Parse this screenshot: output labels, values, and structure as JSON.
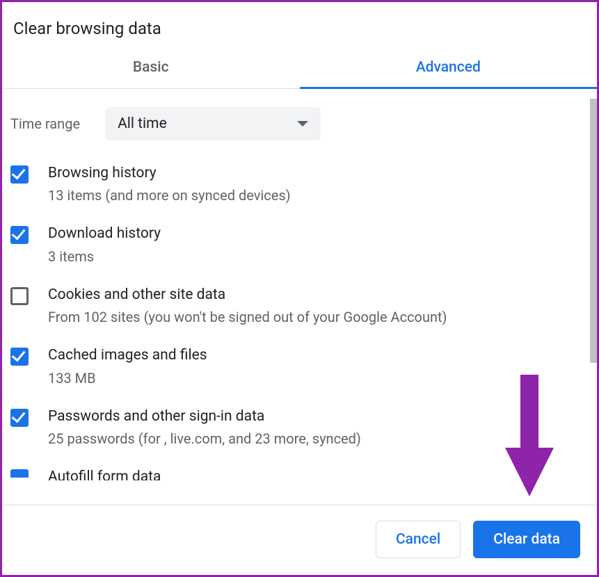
{
  "title": "Clear browsing data",
  "tabs": {
    "basic": "Basic",
    "advanced": "Advanced",
    "active": "advanced"
  },
  "time_range": {
    "label": "Time range",
    "value": "All time"
  },
  "options": [
    {
      "title": "Browsing history",
      "sub": "13 items (and more on synced devices)",
      "checked": true
    },
    {
      "title": "Download history",
      "sub": "3 items",
      "checked": true
    },
    {
      "title": "Cookies and other site data",
      "sub": "From 102 sites (you won't be signed out of your Google Account)",
      "checked": false
    },
    {
      "title": "Cached images and files",
      "sub": "133 MB",
      "checked": true
    },
    {
      "title": "Passwords and other sign-in data",
      "sub": "25 passwords (for , live.com, and 23 more, synced)",
      "checked": true
    },
    {
      "title": "Autofill form data",
      "sub": "",
      "checked": true
    }
  ],
  "footer": {
    "cancel": "Cancel",
    "clear": "Clear data"
  },
  "annotation": {
    "arrow_color": "#8e24aa"
  }
}
